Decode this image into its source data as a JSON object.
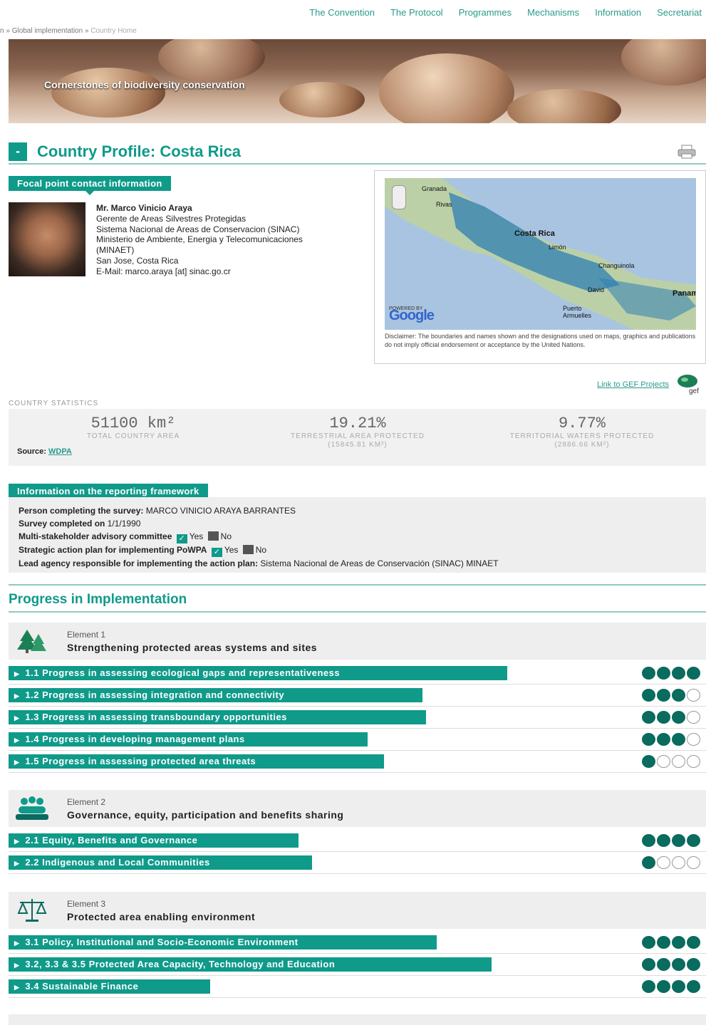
{
  "nav": [
    "The Convention",
    "The Protocol",
    "Programmes",
    "Mechanisms",
    "Information",
    "Secretariat"
  ],
  "breadcrumb": {
    "prefix": "n »",
    "item": "Global implementation",
    "sep": "»",
    "current": "Country Home"
  },
  "banner": {
    "text": "Cornerstones of biodiversity conservation"
  },
  "profile": {
    "collapse": "-",
    "title": "Country Profile: Costa Rica"
  },
  "focal": {
    "label": "Focal point contact information",
    "name": "Mr. Marco Vinicio Araya",
    "lines": [
      "Gerente de Areas Silvestres Protegidas",
      "Sistema Nacional de Areas de Conservacion (SINAC)",
      "Ministerio de Ambiente, Energia y Telecomunicaciones (MINAET)",
      "San Jose, Costa Rica",
      "E-Mail: marco.araya [at] sinac.go.cr"
    ]
  },
  "map": {
    "labels": [
      "Granada",
      "Rivas",
      "Costa Rica",
      "Limón",
      "Changuinola",
      "David",
      "Puerto Armuelles",
      "Panama"
    ],
    "logo": "Google",
    "powered": "POWERED BY",
    "disclaimer": "Disclaimer: The boundaries and names shown and the designations used on maps, graphics and publications do not imply official endorsement or acceptance by the United Nations."
  },
  "gef": {
    "link": "Link to GEF Projects",
    "logo": "gef"
  },
  "stats": {
    "label": "COUNTRY STATISTICS",
    "items": [
      {
        "value": "51100 km²",
        "label": "TOTAL COUNTRY AREA",
        "sub": ""
      },
      {
        "value": "19.21%",
        "label": "TERRESTRIAL AREA PROTECTED",
        "sub": "(15845.81 KM²)"
      },
      {
        "value": "9.77%",
        "label": "TERRITORIAL WATERS PROTECTED",
        "sub": "(2886.66 KM²)"
      }
    ],
    "source_label": "Source:",
    "source_link": "WDPA"
  },
  "reporting": {
    "label": "Information on the reporting framework",
    "person_label": "Person completing the survey:",
    "person_value": "MARCO VINICIO ARAYA BARRANTES",
    "survey_label": "Survey completed on",
    "survey_value": "1/1/1990",
    "committee_label": "Multi-stakeholder advisory committee",
    "plan_label": "Strategic action plan for implementing PoWPA",
    "yes": "Yes",
    "no": "No",
    "agency_label": "Lead agency responsible for implementing the action plan:",
    "agency_value": "Sistema Nacional de Areas de Conservación (SINAC) MINAET"
  },
  "progress_title": "Progress in Implementation",
  "elements": [
    {
      "num": "Element 1",
      "title": "Strengthening protected areas systems and sites",
      "icon": "trees-icon",
      "rows": [
        {
          "label": "1.1 Progress in assessing ecological gaps and representativeness",
          "level": 4
        },
        {
          "label": "1.2 Progress in assessing integration and connectivity",
          "level": 3
        },
        {
          "label": "1.3 Progress in assessing transboundary opportunities",
          "level": 3
        },
        {
          "label": "1.4 Progress in developing management plans",
          "level": 3
        },
        {
          "label": "1.5 Progress in assessing protected area threats",
          "level": 1
        }
      ]
    },
    {
      "num": "Element 2",
      "title": "Governance, equity, participation and benefits sharing",
      "icon": "people-icon",
      "rows": [
        {
          "label": "2.1 Equity, Benefits and Governance",
          "level": 4
        },
        {
          "label": "2.2 Indigenous and Local Communities",
          "level": 1
        }
      ]
    },
    {
      "num": "Element 3",
      "title": "Protected area enabling environment",
      "icon": "scales-icon",
      "rows": [
        {
          "label": "3.1 Policy, Institutional and Socio-Economic Environment",
          "level": 4
        },
        {
          "label": "3.2, 3.3 & 3.5 Protected Area Capacity, Technology and Education",
          "level": 4
        },
        {
          "label": "3.4 Sustainable Finance",
          "level": 4
        }
      ]
    }
  ],
  "colors": {
    "accent": "#0f9a8a",
    "dot": "#0a6b5f"
  }
}
